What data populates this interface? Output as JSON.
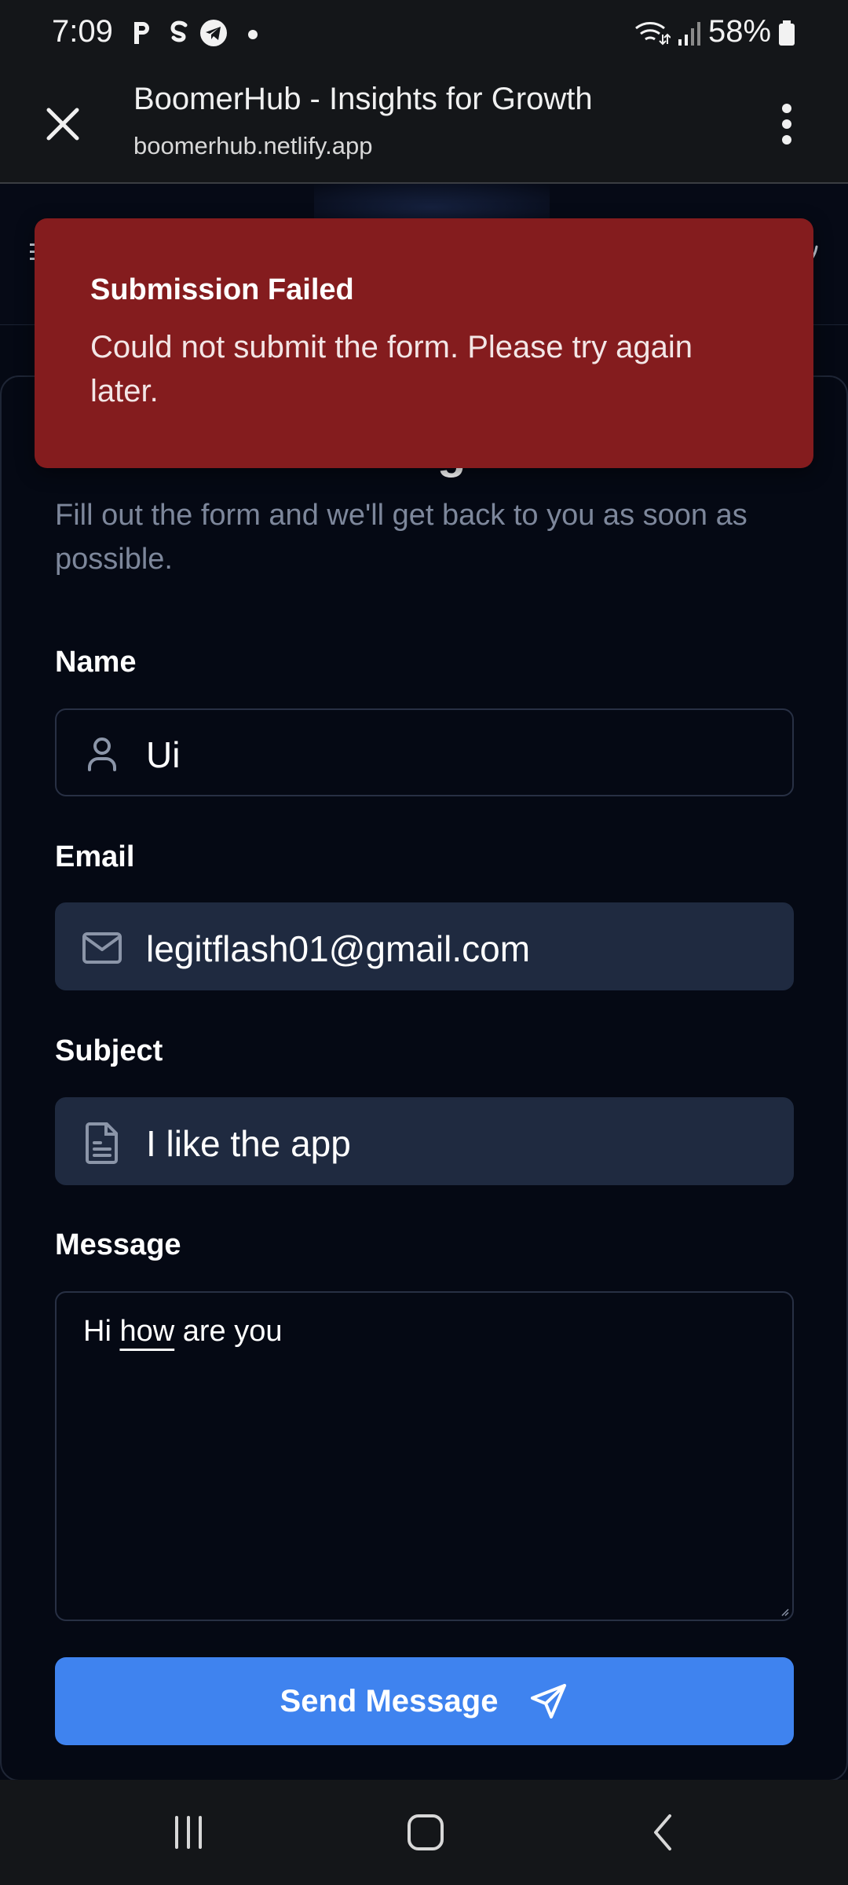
{
  "status_bar": {
    "time": "7:09",
    "notification_icons": [
      "parking-p-icon",
      "sync-s-icon",
      "telegram-icon",
      "dot-icon"
    ],
    "system_icons": [
      "wifi-icon",
      "signal-icon"
    ],
    "battery_percent": "58%"
  },
  "browser": {
    "title": "BoomerHub - Insights for Growth",
    "url": "boomerhub.netlify.app"
  },
  "toast": {
    "title": "Submission Failed",
    "message": "Could not submit the form. Please try again later."
  },
  "card": {
    "title": "Send us a message",
    "subtitle": "Fill out the form and we'll get back to you as soon as possible."
  },
  "form": {
    "name": {
      "label": "Name",
      "value": "Ui",
      "icon": "user-icon"
    },
    "email": {
      "label": "Email",
      "value": "legitflash01@gmail.com",
      "icon": "mail-icon"
    },
    "subject": {
      "label": "Subject",
      "value": "I like the app",
      "icon": "document-icon"
    },
    "message": {
      "label": "Message",
      "value_before": "Hi ",
      "value_underlined": "how",
      "value_after": " are you"
    },
    "submit_label": "Send Message"
  },
  "colors": {
    "background": "#050914",
    "toast_bg": "#841c1e",
    "input_filled": "#1f2a40",
    "accent": "#3f83ef",
    "muted_text": "#7d879b"
  }
}
